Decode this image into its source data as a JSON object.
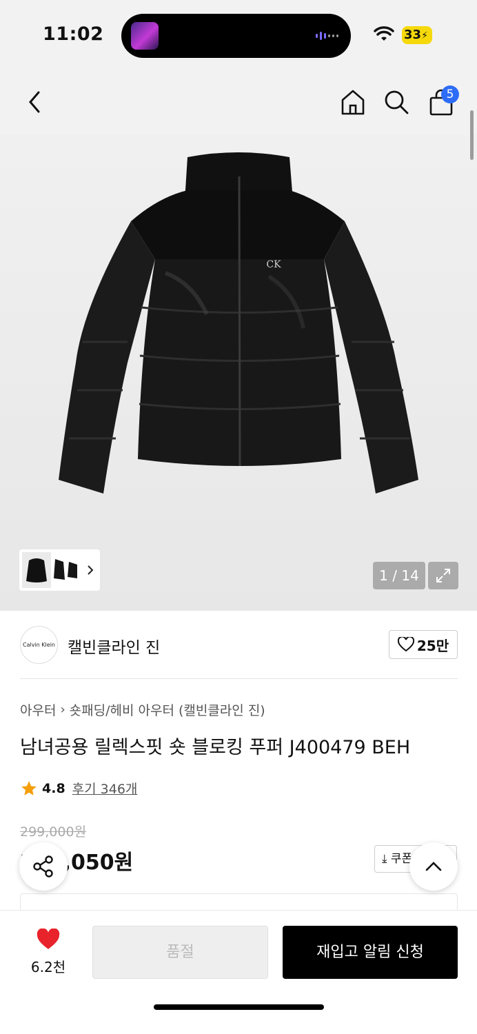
{
  "status": {
    "time": "11:02",
    "battery": "33"
  },
  "header": {
    "cart_count": "5"
  },
  "gallery": {
    "counter": "1 / 14",
    "image_alt": "black puffer jacket"
  },
  "brand": {
    "logo_text": "Calvin Klein",
    "name": "캘빈클라인 진",
    "likes": "25만"
  },
  "breadcrumb": {
    "first": "아우터",
    "second": "숏패딩/헤비 아우터 (캘빈클라인 진)"
  },
  "product": {
    "title": "남녀공용 릴렉스핏 숏 블로킹 푸퍼 J400479 BEH",
    "rating": "4.8",
    "reviews": "후기 346개",
    "original_price": "299,000원",
    "sale_price": "284,050원",
    "coupon_label": "쿠폰"
  },
  "bottom": {
    "wish_count": "6.2천",
    "soldout_label": "품절",
    "restock_label": "재입고 알림 신청"
  },
  "colors": {
    "accent_blue": "#2d6cf6",
    "heart_red": "#e8232b",
    "star": "#f59e0b"
  }
}
